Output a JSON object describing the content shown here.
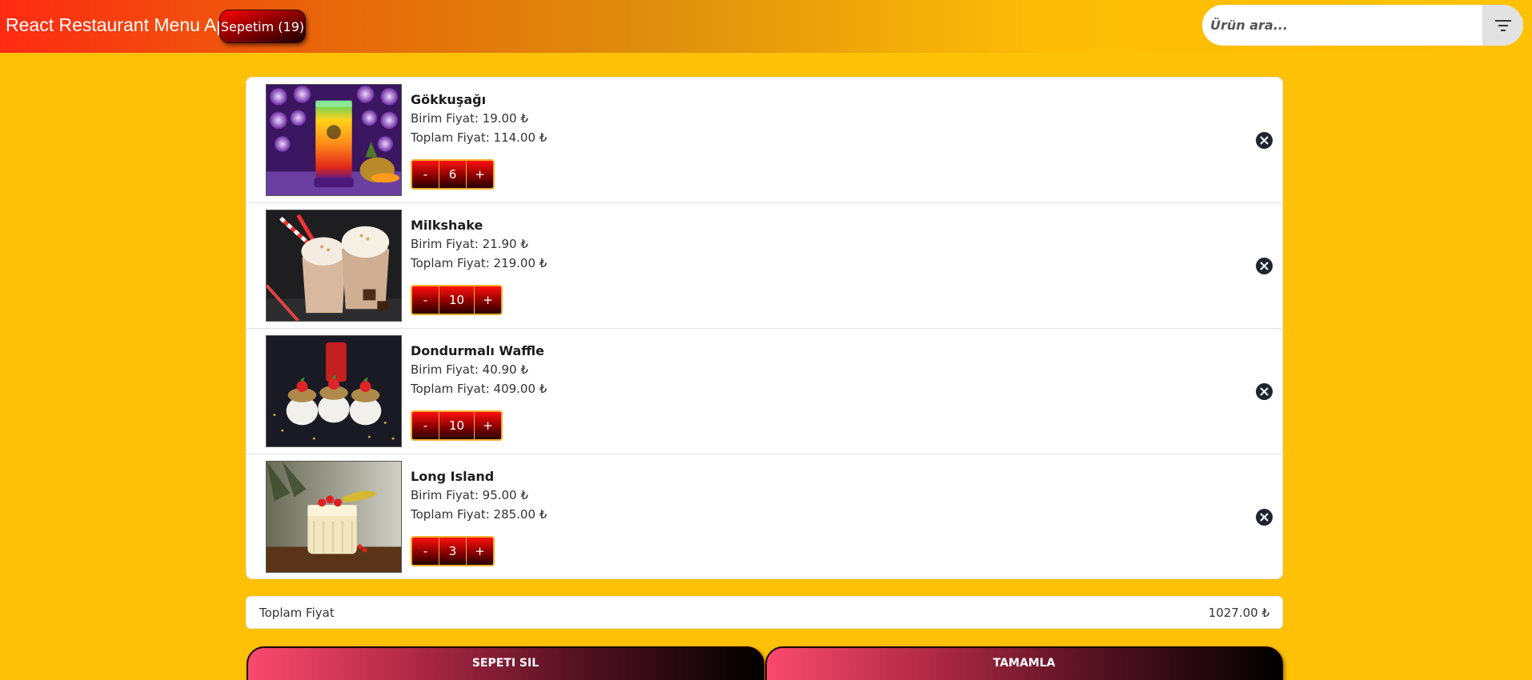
{
  "header": {
    "brand": "React Restaurant Menu App",
    "cart_label": "Sepetim (19)",
    "search_placeholder": "Ürün ara...",
    "filter_icon": "filter-icon"
  },
  "cart": {
    "items": [
      {
        "name": "Gökkuşağı",
        "unit_price": "Birim Fiyat: 19.00 ₺",
        "total_price": "Toplam Fiyat: 114.00 ₺",
        "quantity": "6",
        "decrement": "-",
        "increment": "+"
      },
      {
        "name": "Milkshake",
        "unit_price": "Birim Fiyat: 21.90 ₺",
        "total_price": "Toplam Fiyat: 219.00 ₺",
        "quantity": "10",
        "decrement": "-",
        "increment": "+"
      },
      {
        "name": "Dondurmalı Waffle",
        "unit_price": "Birim Fiyat: 40.90 ₺",
        "total_price": "Toplam Fiyat: 409.00 ₺",
        "quantity": "10",
        "decrement": "-",
        "increment": "+"
      },
      {
        "name": "Long Island",
        "unit_price": "Birim Fiyat: 95.00 ₺",
        "total_price": "Toplam Fiyat: 285.00 ₺",
        "quantity": "3",
        "decrement": "-",
        "increment": "+"
      }
    ]
  },
  "summary": {
    "total_label": "Toplam Fiyat",
    "total_value": "1027.00 ₺"
  },
  "actions": {
    "clear_label": "SEPETI SIL",
    "complete_label": "TAMAMLA"
  },
  "colors": {
    "background": "#ffc107",
    "header_start": "#ff2a12",
    "button_red": "#ff1010",
    "remove_icon": "#1c2530"
  }
}
